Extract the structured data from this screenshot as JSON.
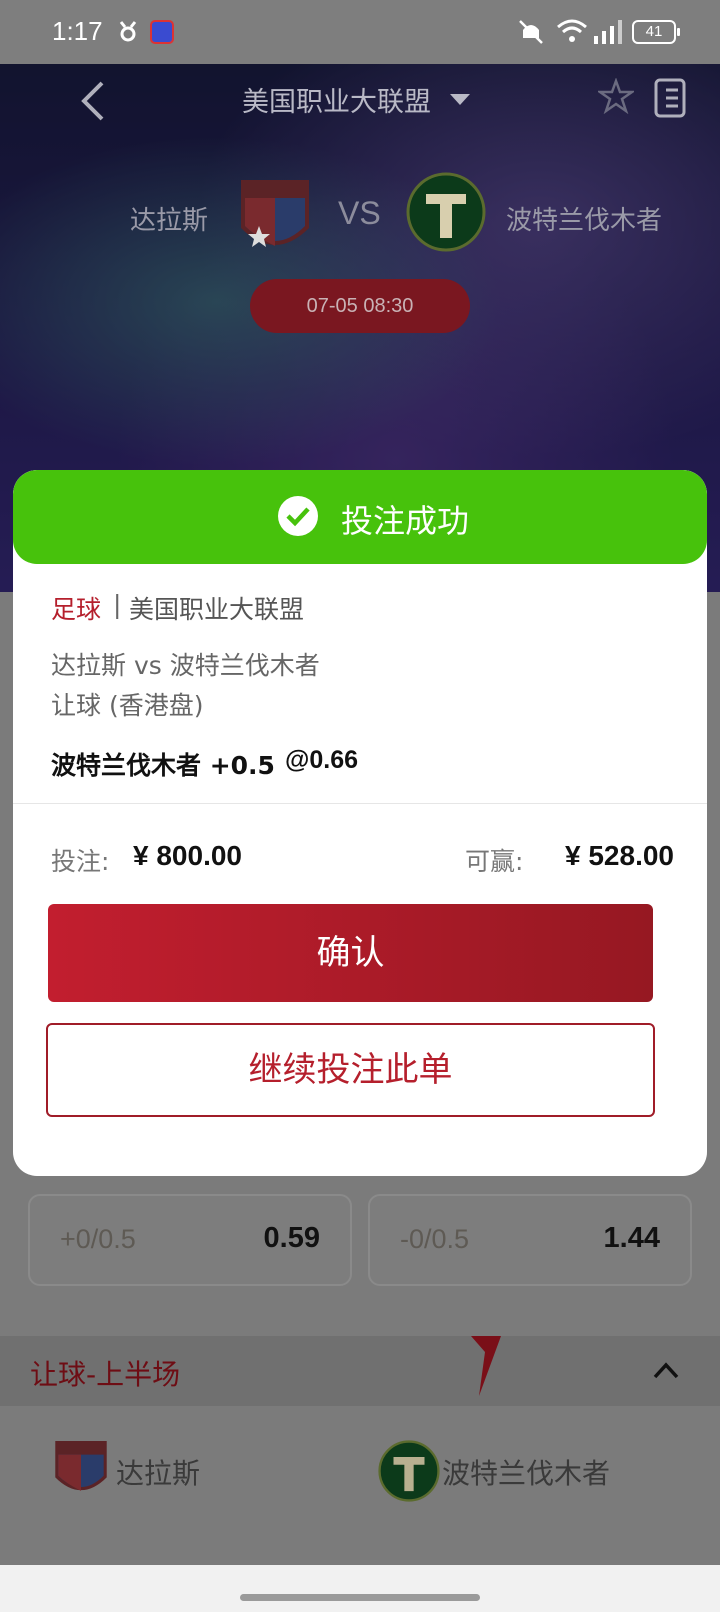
{
  "status_bar": {
    "time": "1:17",
    "battery": "41"
  },
  "header": {
    "league": "美国职业大联盟"
  },
  "match": {
    "home": "达拉斯",
    "away": "波特兰伐木者",
    "vs": "VS",
    "kickoff": "07-05 08:30"
  },
  "odds_row": [
    {
      "line": "+0/0.5",
      "price": "0.59"
    },
    {
      "line": "-0/0.5",
      "price": "1.44"
    }
  ],
  "section": {
    "title": "让球-上半场"
  },
  "lower_teams": {
    "home": "达拉斯",
    "away": "波特兰伐木者"
  },
  "modal": {
    "title": "投注成功",
    "sport": "足球",
    "separator": "|",
    "league": "美国职业大联盟",
    "match": "达拉斯 vs 波特兰伐木者",
    "market": "让球 (香港盘)",
    "pick": "波特兰伐木者 +0.5",
    "odds": "@0.66",
    "stake_label": "投注:",
    "stake_value": "¥ 800.00",
    "win_label": "可赢:",
    "win_value": "¥ 528.00",
    "confirm_label": "确认",
    "again_label": "继续投注此单"
  },
  "colors": {
    "success": "#47c20c",
    "brand_red": "#b51f2c"
  }
}
